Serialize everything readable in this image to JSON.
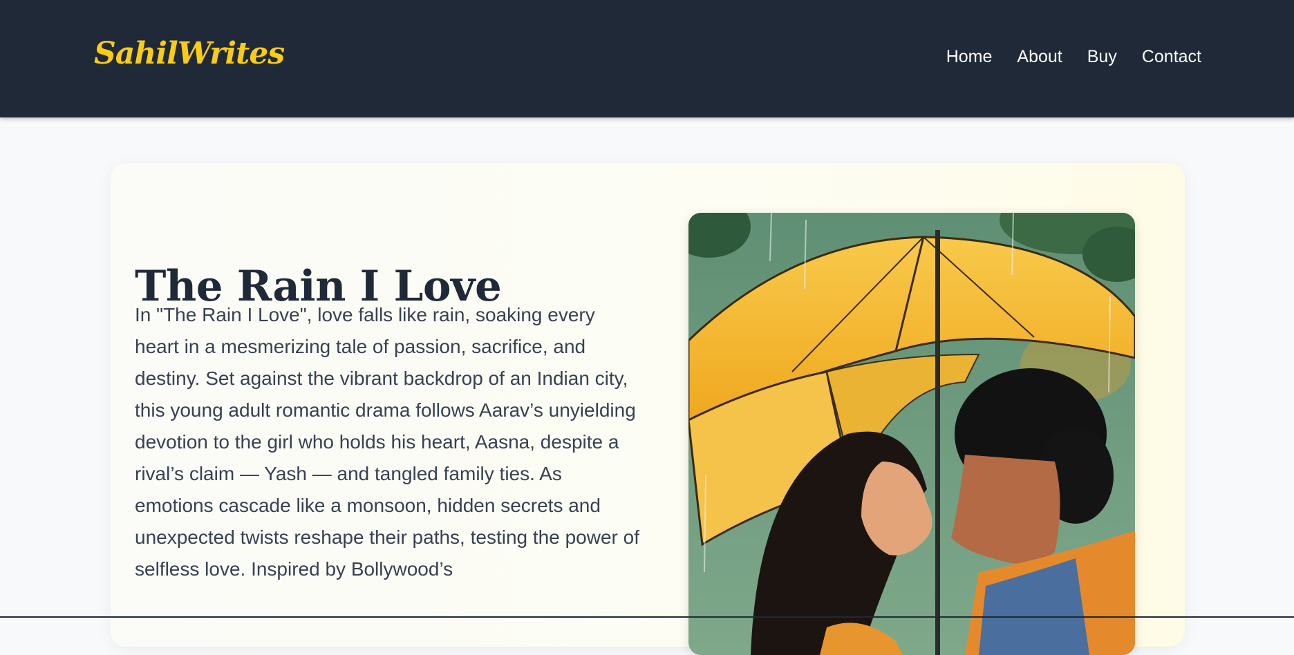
{
  "header": {
    "brand": "SahilWrites",
    "nav": [
      "Home",
      "About",
      "Buy",
      "Contact"
    ]
  },
  "book": {
    "title": "The Rain I Love",
    "description": "In \"The Rain I Love\", love falls like rain, soaking every heart in a mesmerizing tale of passion, sacrifice, and destiny. Set against the vibrant backdrop of an Indian city, this young adult romantic drama follows Aarav’s unyielding devotion to the girl who holds his heart, Aasna, despite a rival’s claim — Yash — and tangled family ties. As emotions cascade like a monsoon, hidden secrets and unexpected twists reshape their paths, testing the power of selfless love. Inspired by Bollywood’s"
  },
  "colors": {
    "header_bg": "#1f2937",
    "brand_accent": "#facc15",
    "page_bg": "#f8f9fb",
    "text_dark": "#1f2937",
    "text_body": "#374151"
  },
  "icons": {
    "cover": "book-cover-illustration"
  }
}
